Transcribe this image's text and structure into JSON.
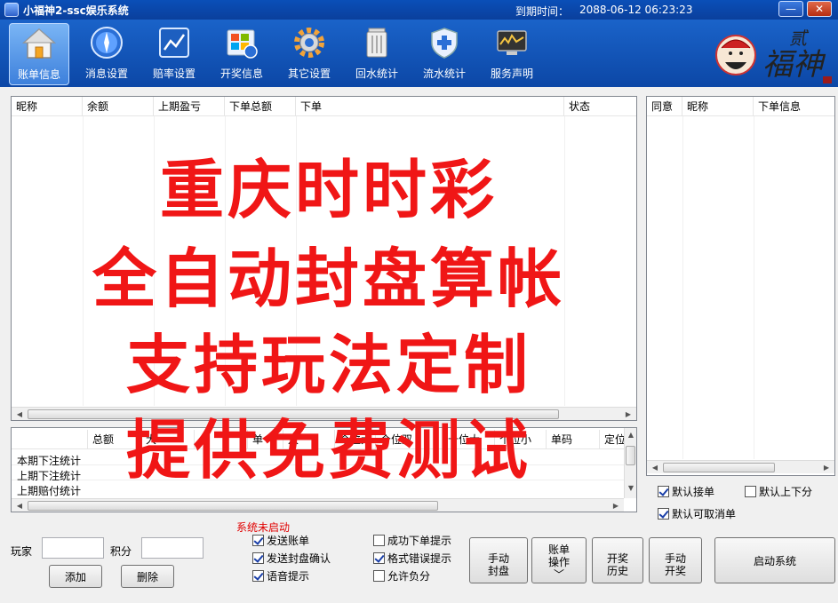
{
  "window": {
    "title": "小福神2-ssc娱乐系统",
    "expire_label": "到期时间：",
    "expire_value": "2088-06-12 06:23:23",
    "min_label": "—",
    "close_label": "✕"
  },
  "toolbar": {
    "items": [
      {
        "label": "账单信息",
        "icon": "home-icon"
      },
      {
        "label": "消息设置",
        "icon": "compass-icon"
      },
      {
        "label": "赔率设置",
        "icon": "chart-icon"
      },
      {
        "label": "开奖信息",
        "icon": "windows-refresh-icon"
      },
      {
        "label": "其它设置",
        "icon": "gear-icon"
      },
      {
        "label": "回水统计",
        "icon": "trash-icon"
      },
      {
        "label": "流水统计",
        "icon": "shield-icon"
      },
      {
        "label": "服务声明",
        "icon": "monitor-icon"
      }
    ]
  },
  "logo": {
    "text": "福神",
    "small": "贰"
  },
  "main_grid": {
    "columns": [
      "昵称",
      "余额",
      "上期盈亏",
      "下单总额",
      "下单",
      "状态"
    ]
  },
  "stats_grid": {
    "columns": [
      "总额",
      "大",
      "小",
      "单",
      "双",
      "个位大",
      "个位双",
      "十位大",
      "个位小",
      "单码",
      "定位"
    ],
    "rows": [
      "本期下注统计",
      "上期下注统计",
      "上期赔付统计"
    ]
  },
  "right_grid": {
    "columns": [
      "同意",
      "昵称",
      "下单信息"
    ]
  },
  "overlay": {
    "line1": "重庆时时彩",
    "line2": "全自动封盘算帐",
    "line3": "支持玩法定制",
    "line4": "提供免费测试"
  },
  "right_checks": {
    "auto_accept": "默认接单",
    "auto_updown": "默认上下分",
    "auto_cancel": "默认可取消单"
  },
  "bottom": {
    "player_label": "玩家",
    "score_label": "积分",
    "add_button": "添加",
    "delete_button": "删除",
    "status": "系统未启动",
    "send_bill": "发送账单",
    "send_close_confirm": "发送封盘确认",
    "voice_prompt": "语音提示",
    "success_prompt": "成功下单提示",
    "format_error_prompt": "格式错误提示",
    "allow_negative": "允许负分",
    "manual_close_1": "手动",
    "manual_close_2": "封盘",
    "bill_op_1": "账单",
    "bill_op_2": "操作",
    "bill_op_3": "﹀",
    "draw_history_1": "开奖",
    "draw_history_2": "历史",
    "manual_draw_1": "手动",
    "manual_draw_2": "开奖",
    "start_system": "启动系统"
  }
}
